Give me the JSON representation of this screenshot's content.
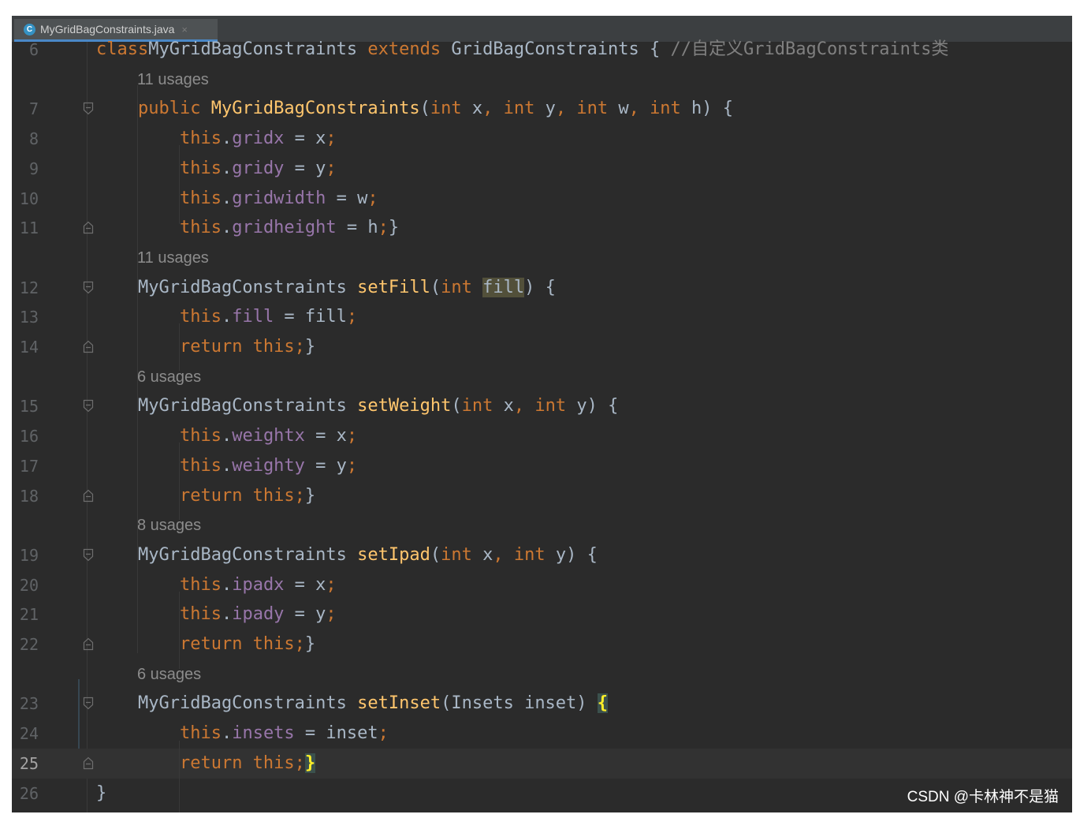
{
  "tab": {
    "icon": "class-c-icon",
    "icon_letter": "C",
    "filename": "MyGridBagConstraints.java",
    "close_glyph": "×"
  },
  "lines": [
    {
      "n": "6",
      "tokens": [
        [
          "kw",
          "class"
        ],
        [
          "",
          "MyGridBagConstraints "
        ],
        [
          "kw",
          "extends"
        ],
        [
          "",
          " GridBagConstraints { "
        ],
        [
          "cmt",
          "//自定义GridBagConstraints类"
        ]
      ]
    },
    {
      "hint": "11 usages"
    },
    {
      "n": "7",
      "fold": "start",
      "tokens": [
        [
          "",
          "    "
        ],
        [
          "kw",
          "public "
        ],
        [
          "mth",
          "MyGridBagConstraints"
        ],
        [
          "",
          "("
        ],
        [
          "kw",
          "int "
        ],
        [
          "",
          "x"
        ],
        [
          "kw",
          ", "
        ],
        [
          "kw",
          "int "
        ],
        [
          "",
          "y"
        ],
        [
          "kw",
          ", "
        ],
        [
          "kw",
          "int "
        ],
        [
          "",
          "w"
        ],
        [
          "kw",
          ", "
        ],
        [
          "kw",
          "int "
        ],
        [
          "",
          "h) {"
        ]
      ]
    },
    {
      "n": "8",
      "tokens": [
        [
          "",
          "        "
        ],
        [
          "kw",
          "this"
        ],
        [
          "",
          "."
        ],
        [
          "fld",
          "gridx"
        ],
        [
          "",
          " = x"
        ],
        [
          "kw",
          ";"
        ]
      ]
    },
    {
      "n": "9",
      "tokens": [
        [
          "",
          "        "
        ],
        [
          "kw",
          "this"
        ],
        [
          "",
          "."
        ],
        [
          "fld",
          "gridy"
        ],
        [
          "",
          " = y"
        ],
        [
          "kw",
          ";"
        ]
      ]
    },
    {
      "n": "10",
      "tokens": [
        [
          "",
          "        "
        ],
        [
          "kw",
          "this"
        ],
        [
          "",
          "."
        ],
        [
          "fld",
          "gridwidth"
        ],
        [
          "",
          " = w"
        ],
        [
          "kw",
          ";"
        ]
      ]
    },
    {
      "n": "11",
      "fold": "end",
      "tokens": [
        [
          "",
          "        "
        ],
        [
          "kw",
          "this"
        ],
        [
          "",
          "."
        ],
        [
          "fld",
          "gridheight"
        ],
        [
          "",
          " = h"
        ],
        [
          "kw",
          ";"
        ],
        [
          "",
          "}"
        ]
      ]
    },
    {
      "hint": "11 usages"
    },
    {
      "n": "12",
      "fold": "start",
      "tokens": [
        [
          "",
          "    MyGridBagConstraints "
        ],
        [
          "mth",
          "setFill"
        ],
        [
          "",
          "("
        ],
        [
          "kw",
          "int "
        ],
        [
          "occ",
          "fill"
        ],
        [
          "",
          ") {"
        ]
      ]
    },
    {
      "n": "13",
      "tokens": [
        [
          "",
          "        "
        ],
        [
          "kw",
          "this"
        ],
        [
          "",
          "."
        ],
        [
          "fld",
          "fill"
        ],
        [
          "",
          " = fill"
        ],
        [
          "kw",
          ";"
        ]
      ]
    },
    {
      "n": "14",
      "fold": "end",
      "tokens": [
        [
          "",
          "        "
        ],
        [
          "kw",
          "return this;"
        ],
        [
          "",
          "}"
        ]
      ]
    },
    {
      "hint": "6 usages"
    },
    {
      "n": "15",
      "fold": "start",
      "tokens": [
        [
          "",
          "    MyGridBagConstraints "
        ],
        [
          "mth",
          "setWeight"
        ],
        [
          "",
          "("
        ],
        [
          "kw",
          "int "
        ],
        [
          "",
          "x"
        ],
        [
          "kw",
          ", "
        ],
        [
          "kw",
          "int "
        ],
        [
          "",
          "y) {"
        ]
      ]
    },
    {
      "n": "16",
      "tokens": [
        [
          "",
          "        "
        ],
        [
          "kw",
          "this"
        ],
        [
          "",
          "."
        ],
        [
          "fld",
          "weightx"
        ],
        [
          "",
          " = x"
        ],
        [
          "kw",
          ";"
        ]
      ]
    },
    {
      "n": "17",
      "tokens": [
        [
          "",
          "        "
        ],
        [
          "kw",
          "this"
        ],
        [
          "",
          "."
        ],
        [
          "fld",
          "weighty"
        ],
        [
          "",
          " = y"
        ],
        [
          "kw",
          ";"
        ]
      ]
    },
    {
      "n": "18",
      "fold": "end",
      "tokens": [
        [
          "",
          "        "
        ],
        [
          "kw",
          "return this;"
        ],
        [
          "",
          "}"
        ]
      ]
    },
    {
      "hint": "8 usages"
    },
    {
      "n": "19",
      "fold": "start",
      "tokens": [
        [
          "",
          "    MyGridBagConstraints "
        ],
        [
          "mth",
          "setIpad"
        ],
        [
          "",
          "("
        ],
        [
          "kw",
          "int "
        ],
        [
          "",
          "x"
        ],
        [
          "kw",
          ", "
        ],
        [
          "kw",
          "int "
        ],
        [
          "",
          "y) {"
        ]
      ]
    },
    {
      "n": "20",
      "tokens": [
        [
          "",
          "        "
        ],
        [
          "kw",
          "this"
        ],
        [
          "",
          "."
        ],
        [
          "fld",
          "ipadx"
        ],
        [
          "",
          " = x"
        ],
        [
          "kw",
          ";"
        ]
      ]
    },
    {
      "n": "21",
      "tokens": [
        [
          "",
          "        "
        ],
        [
          "kw",
          "this"
        ],
        [
          "",
          "."
        ],
        [
          "fld",
          "ipady"
        ],
        [
          "",
          " = y"
        ],
        [
          "kw",
          ";"
        ]
      ]
    },
    {
      "n": "22",
      "fold": "end",
      "tokens": [
        [
          "",
          "        "
        ],
        [
          "kw",
          "return this;"
        ],
        [
          "",
          "}"
        ]
      ]
    },
    {
      "hint": "6 usages"
    },
    {
      "n": "23",
      "fold": "start",
      "tokens": [
        [
          "",
          "    MyGridBagConstraints "
        ],
        [
          "mth",
          "setInset"
        ],
        [
          "",
          "(Insets inset) "
        ],
        [
          "brace",
          "{"
        ]
      ]
    },
    {
      "n": "24",
      "tokens": [
        [
          "",
          "        "
        ],
        [
          "kw",
          "this"
        ],
        [
          "",
          "."
        ],
        [
          "fld",
          "insets"
        ],
        [
          "",
          " = inset"
        ],
        [
          "kw",
          ";"
        ]
      ]
    },
    {
      "n": "25",
      "fold": "end",
      "current": true,
      "tokens": [
        [
          "",
          "        "
        ],
        [
          "kw",
          "return this;"
        ],
        [
          "brace",
          "}"
        ]
      ]
    },
    {
      "n": "26",
      "tokens": [
        [
          "",
          "}"
        ]
      ]
    }
  ],
  "watermark": "CSDN @卡林神不是猫"
}
